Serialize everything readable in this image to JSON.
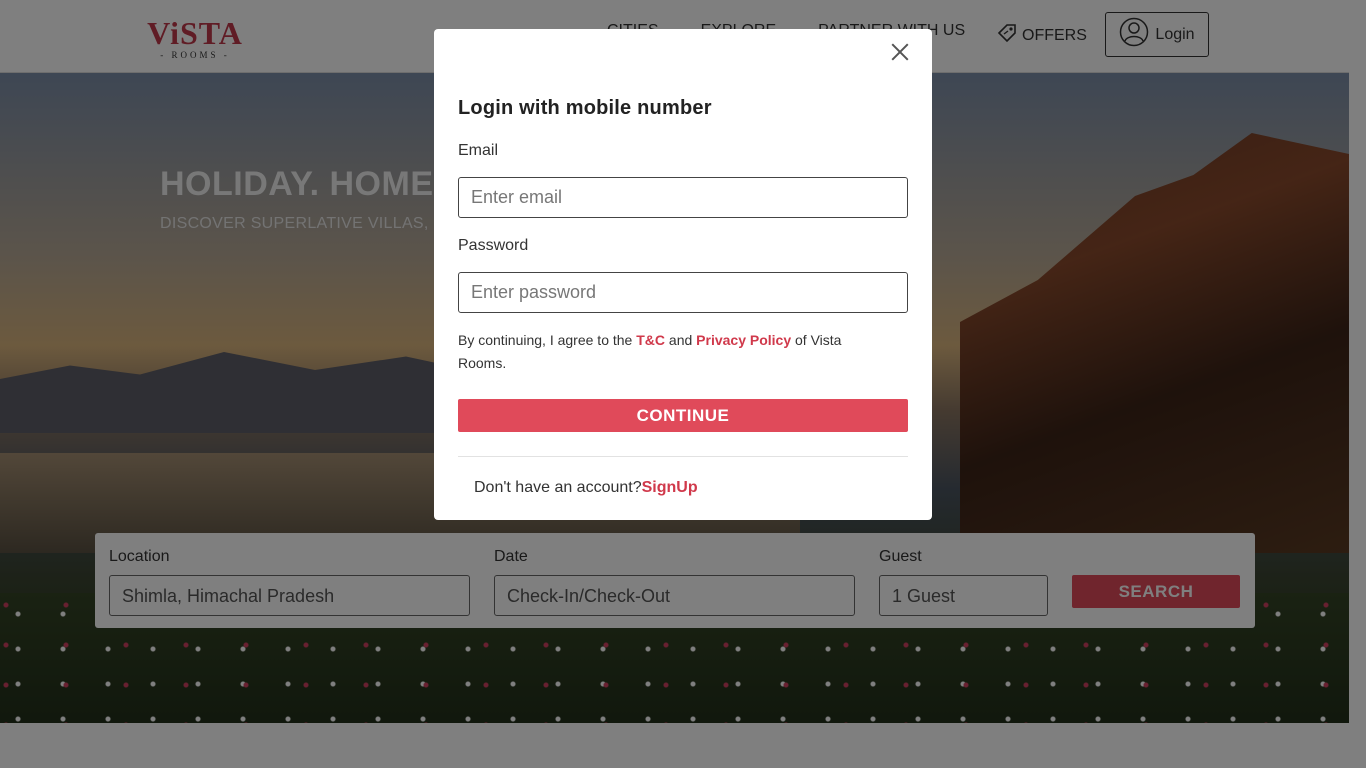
{
  "header": {
    "logo_main": "ViSTA",
    "logo_sub": "ROOMS",
    "nav": [
      {
        "label": "CITIES",
        "has_dropdown": true
      },
      {
        "label": "EXPLORE",
        "has_dropdown": true
      },
      {
        "label": "PARTNER WITH US",
        "has_dropdown": false
      }
    ],
    "offers_label": "OFFERS",
    "offers_icon": "tag-icon",
    "login_label": "Login",
    "login_icon": "user-circle-icon"
  },
  "hero": {
    "title": "HOLIDAY. HOME",
    "subtitle": "DISCOVER SUPERLATIVE VILLAS, I"
  },
  "search": {
    "location_label": "Location",
    "location_value": "Shimla, Himachal Pradesh",
    "date_label": "Date",
    "date_placeholder": "Check-In/Check-Out",
    "guest_label": "Guest",
    "guest_value": "1 Guest",
    "button_label": "SEARCH"
  },
  "modal": {
    "title": "Login with mobile number",
    "email_label": "Email",
    "email_placeholder": "Enter email",
    "password_label": "Password",
    "password_placeholder": "Enter password",
    "terms_prefix": "By continuing, I agree to the ",
    "terms_link": "T&C",
    "terms_and": " and ",
    "privacy_link": "Privacy Policy",
    "terms_suffix": " of Vista Rooms.",
    "continue_label": "CONTINUE",
    "no_account_text": "Don't have an account?",
    "signup_link": "SignUp",
    "close_icon": "close-icon"
  },
  "colors": {
    "accent": "#e04a5a",
    "link": "#d0394b",
    "overlay": "rgba(0,0,0,0.5)"
  }
}
